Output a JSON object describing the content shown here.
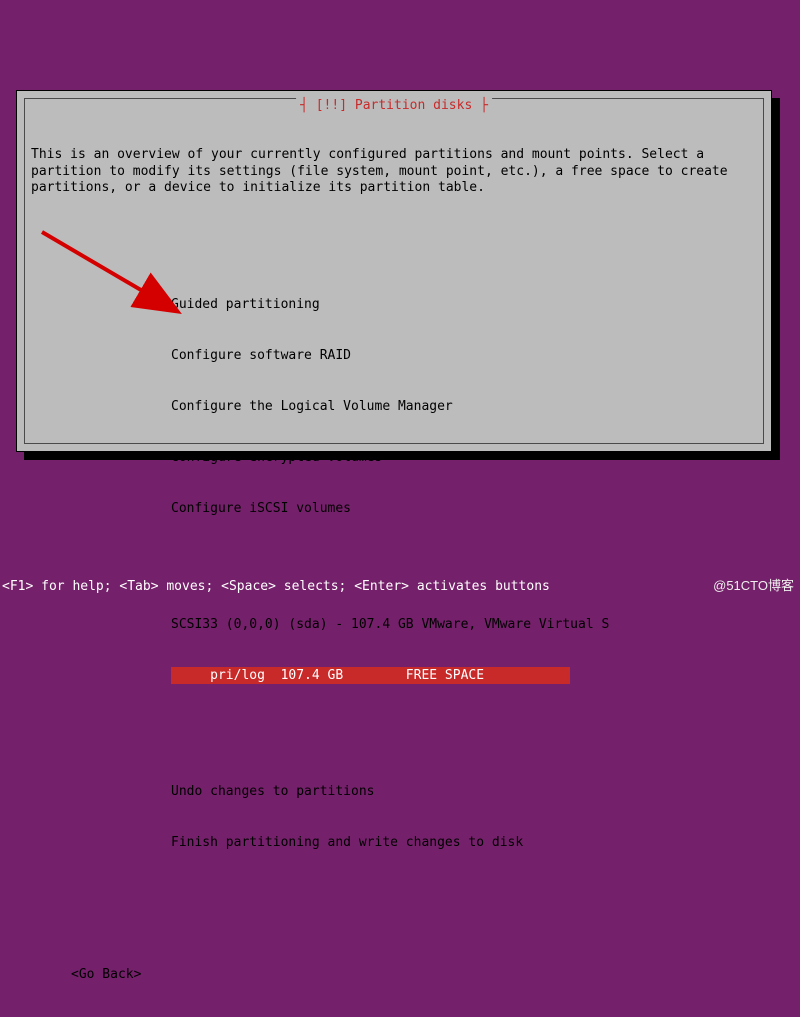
{
  "colors": {
    "bg": "#75206a",
    "dialog": "#bcbcbc",
    "accent": "#c82a2a"
  },
  "dialog": {
    "title_raw": "┤ [!!] Partition disks ├",
    "description": "This is an overview of your currently configured partitions and mount points. Select a partition to modify its settings (file system, mount point, etc.), a free space to create partitions, or a device to initialize its partition table.",
    "menu": [
      "Guided partitioning",
      "Configure software RAID",
      "Configure the Logical Volume Manager",
      "Configure encrypted volumes",
      "Configure iSCSI volumes"
    ],
    "device_line": "SCSI33 (0,0,0) (sda) - 107.4 GB VMware, VMware Virtual S",
    "selected_row": "     pri/log  107.4 GB        FREE SPACE           ",
    "actions": {
      "undo": "Undo changes to partitions",
      "finish": "Finish partitioning and write changes to disk"
    },
    "go_back": "<Go Back>"
  },
  "help_bar": "<F1> for help; <Tab> moves; <Space> selects; <Enter> activates buttons",
  "watermark": "@51CTO博客"
}
